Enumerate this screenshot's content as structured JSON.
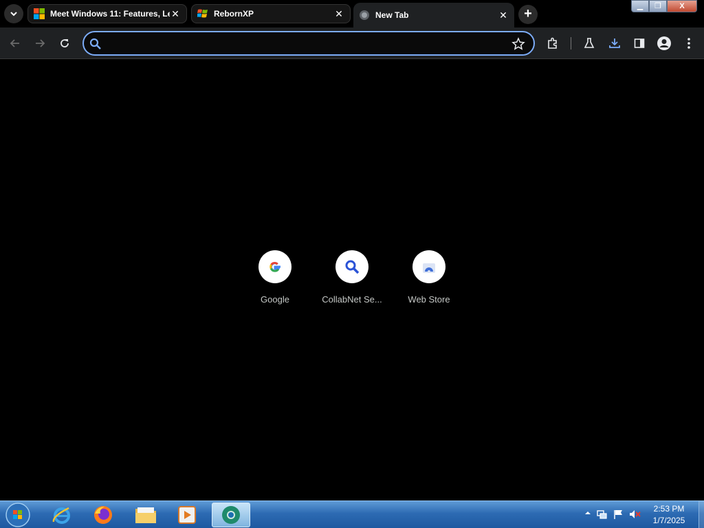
{
  "browser": {
    "tabs": [
      {
        "title": "Meet Windows 11: Features, Le",
        "favicon": "windows-logo-icon",
        "active": false
      },
      {
        "title": "RebornXP",
        "favicon": "windows-xp-logo-icon",
        "active": false
      },
      {
        "title": "New Tab",
        "favicon": "globe-icon",
        "active": true
      }
    ],
    "close_glyph": "✕",
    "new_tab_glyph": "+",
    "window_controls": {
      "minimize": "▁",
      "maximize": "❐",
      "close": "X"
    },
    "omnibox": {
      "value": "",
      "placeholder": ""
    }
  },
  "new_tab_page": {
    "shortcuts": [
      {
        "label": "Google",
        "icon": "google-g-icon"
      },
      {
        "label": "CollabNet Se...",
        "icon": "magnifier-icon"
      },
      {
        "label": "Web Store",
        "icon": "web-store-icon"
      }
    ]
  },
  "taskbar": {
    "apps": [
      "internet-explorer-icon",
      "firefox-icon",
      "file-explorer-icon",
      "media-player-icon",
      "chrome-canary-icon"
    ],
    "clock": {
      "time": "2:53 PM",
      "date": "1/7/2025"
    }
  },
  "colors": {
    "accent": "#7cacf8",
    "toolbar": "#1f2123",
    "taskbar": "#2d6bb3"
  }
}
